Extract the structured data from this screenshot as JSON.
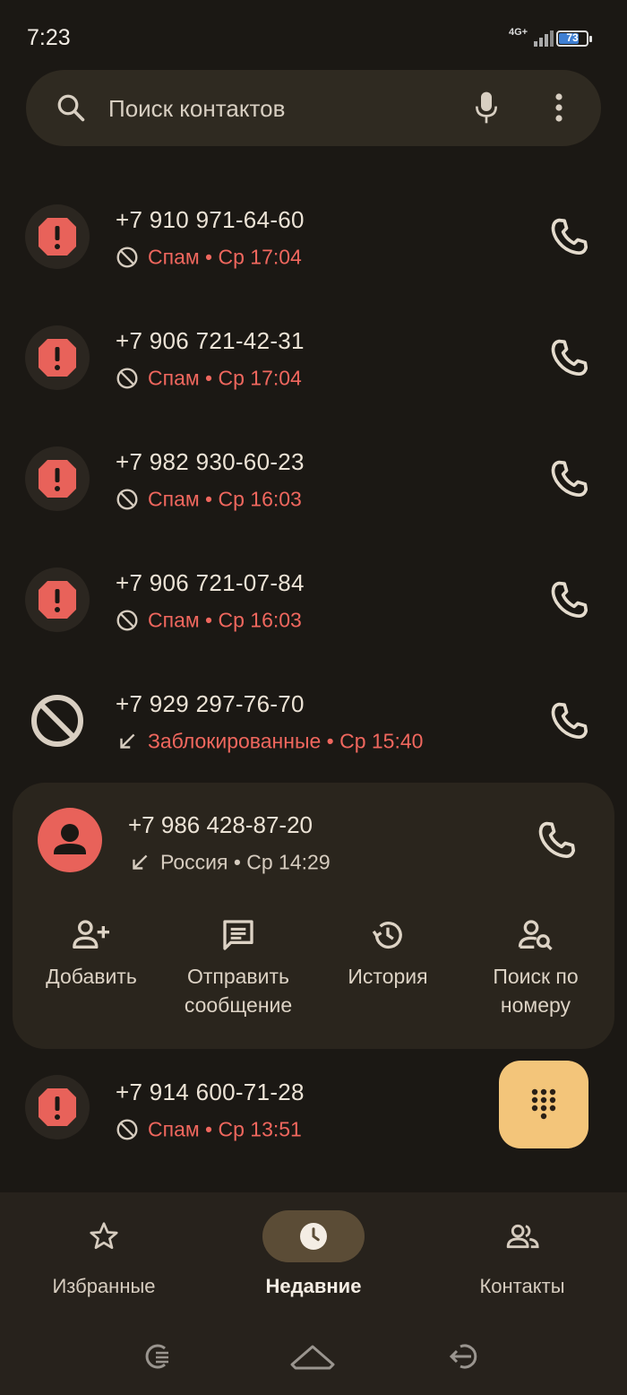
{
  "status_bar": {
    "time": "7:23",
    "network": "4G+",
    "battery": "73",
    "battery_level": 0.73
  },
  "search": {
    "placeholder": "Поиск контактов"
  },
  "calls": [
    {
      "number": "+7 910 971-64-60",
      "meta": "Спам • Ср 17:04",
      "type": "spam",
      "meta_icon": "block-icon"
    },
    {
      "number": "+7 906 721-42-31",
      "meta": "Спам • Ср 17:04",
      "type": "spam",
      "meta_icon": "block-icon"
    },
    {
      "number": "+7 982 930-60-23",
      "meta": "Спам • Ср 16:03",
      "type": "spam",
      "meta_icon": "block-icon"
    },
    {
      "number": "+7 906 721-07-84",
      "meta": "Спам • Ср 16:03",
      "type": "spam",
      "meta_icon": "block-icon"
    },
    {
      "number": "+7 929 297-76-70",
      "meta": "Заблокированные • Ср 15:40",
      "type": "blocked",
      "meta_icon": "incoming-arrow-icon"
    }
  ],
  "expanded_call": {
    "number": "+7 986 428-87-20",
    "meta": "Россия • Ср 14:29",
    "actions": [
      {
        "label": "Добавить",
        "icon": "add-person-icon"
      },
      {
        "label": "Отправить сообщение",
        "icon": "message-icon"
      },
      {
        "label": "История",
        "icon": "history-icon"
      },
      {
        "label": "Поиск по номеру",
        "icon": "person-search-icon"
      }
    ]
  },
  "last_call": {
    "number": "+7 914 600-71-28",
    "meta": "Спам • Ср 13:51",
    "type": "spam"
  },
  "bottom_nav": {
    "items": [
      {
        "label": "Избранные",
        "icon": "star-icon",
        "active": false
      },
      {
        "label": "Недавние",
        "icon": "clock-icon",
        "active": true
      },
      {
        "label": "Контакты",
        "icon": "contacts-icon",
        "active": false
      }
    ]
  },
  "colors": {
    "background": "#1b1814",
    "spam_red": "#f0675e",
    "fab": "#f3c57a",
    "card": "#2a251d"
  }
}
